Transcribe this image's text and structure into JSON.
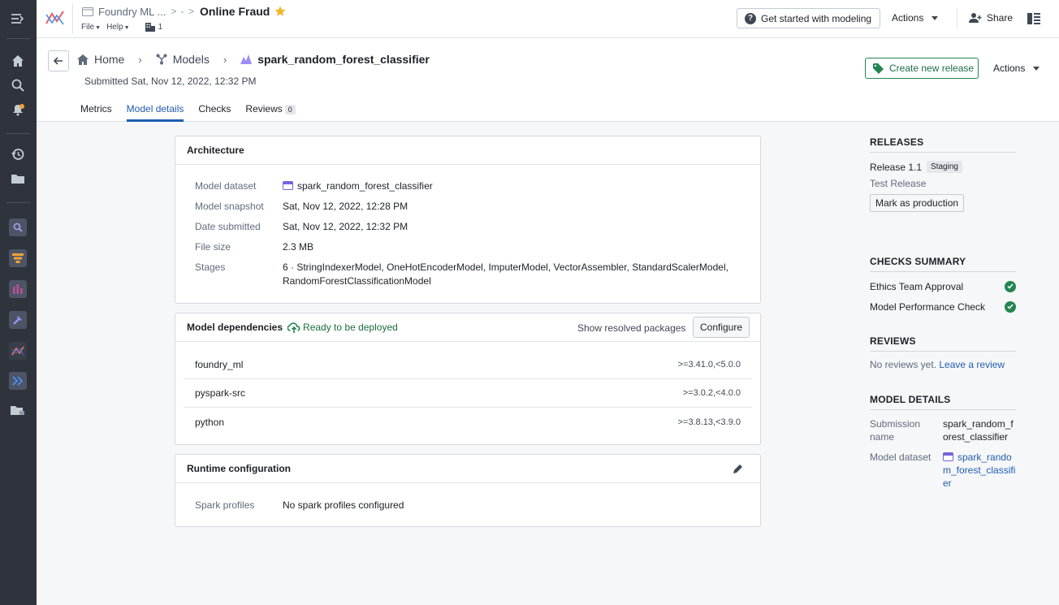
{
  "topbar": {
    "folder": "Foundry ML ...",
    "separator": "> - >",
    "title": "Online Fraud",
    "menus": [
      "File",
      "Help"
    ],
    "count": "1",
    "get_started": "Get started with modeling",
    "actions": "Actions",
    "share": "Share"
  },
  "breadcrumb": {
    "home": "Home",
    "models": "Models",
    "current": "spark_random_forest_classifier"
  },
  "submitted": "Submitted Sat, Nov 12, 2022, 12:32 PM",
  "header": {
    "create_release": "Create new release",
    "actions": "Actions"
  },
  "tabs": [
    {
      "label": "Metrics"
    },
    {
      "label": "Model details",
      "active": true
    },
    {
      "label": "Checks"
    },
    {
      "label": "Reviews",
      "count": "0"
    }
  ],
  "architecture": {
    "title": "Architecture",
    "rows": [
      {
        "key": "Model dataset",
        "value": "spark_random_forest_classifier"
      },
      {
        "key": "Model snapshot",
        "value": "Sat, Nov 12, 2022, 12:28 PM"
      },
      {
        "key": "Date submitted",
        "value": "Sat, Nov 12, 2022, 12:32 PM"
      },
      {
        "key": "File size",
        "value": "2.3 MB"
      },
      {
        "key": "Stages",
        "value": "6 · StringIndexerModel, OneHotEncoderModel, ImputerModel, VectorAssembler, StandardScalerModel, RandomForestClassificationModel"
      }
    ]
  },
  "dependencies": {
    "title": "Model dependencies",
    "status": "Ready to be deployed",
    "show_resolved": "Show resolved packages",
    "configure": "Configure",
    "packages": [
      {
        "name": "foundry_ml",
        "version": ">=3.41.0,<5.0.0"
      },
      {
        "name": "pyspark-src",
        "version": ">=3.0.2,<4.0.0"
      },
      {
        "name": "python",
        "version": ">=3.8.13,<3.9.0"
      }
    ]
  },
  "runtime": {
    "title": "Runtime configuration",
    "key": "Spark profiles",
    "value": "No spark profiles configured"
  },
  "releases": {
    "title": "RELEASES",
    "release": "Release 1.1",
    "tag": "Staging",
    "desc": "Test Release",
    "mark": "Mark as production"
  },
  "checks": {
    "title": "CHECKS SUMMARY",
    "items": [
      {
        "label": "Ethics Team Approval"
      },
      {
        "label": "Model Performance Check"
      }
    ]
  },
  "reviews": {
    "title": "REVIEWS",
    "none": "No reviews yet.",
    "leave": "Leave a review"
  },
  "model_details": {
    "title": "MODEL DETAILS",
    "submission_label_1": "Submission",
    "submission_label_2": "name",
    "submission_value_1": "spark_random_f",
    "submission_value_2": "orest_classifier",
    "dataset_label": "Model dataset",
    "dataset_value_1": "spark_rando",
    "dataset_value_2": "m_forest_classifi",
    "dataset_value_3": "er"
  }
}
